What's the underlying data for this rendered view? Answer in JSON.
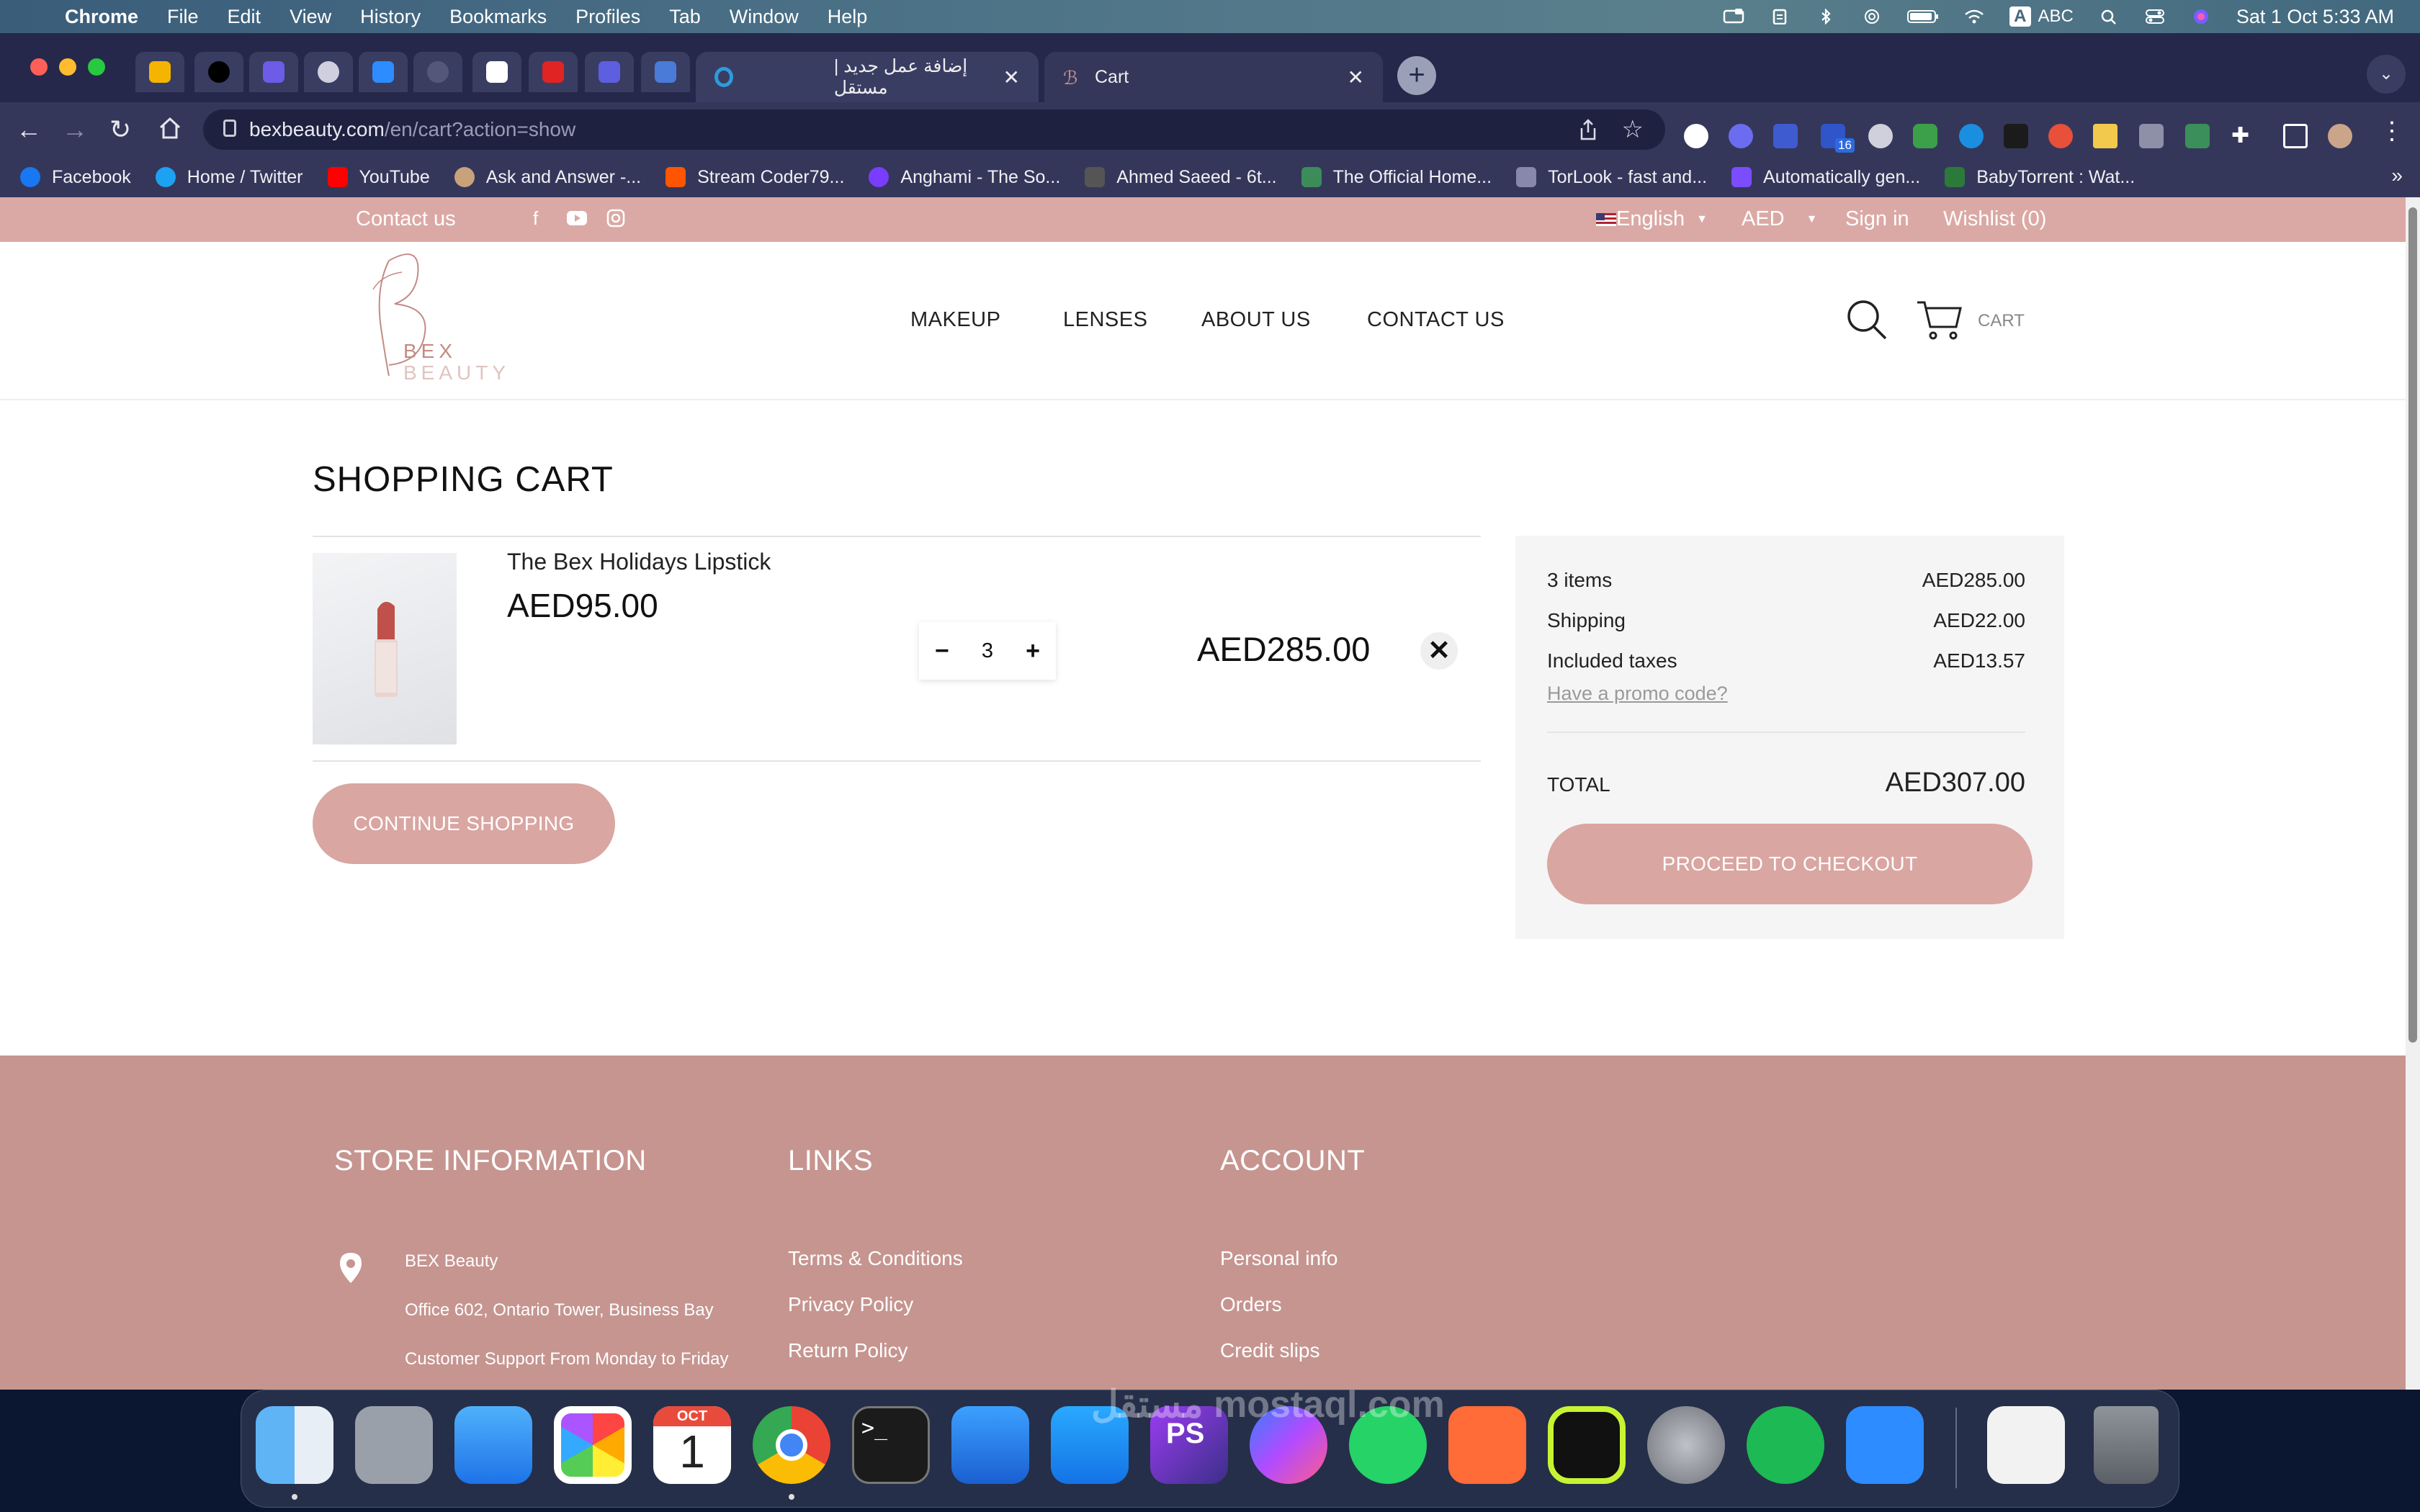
{
  "menubar": {
    "app": "Chrome",
    "items": [
      "File",
      "Edit",
      "View",
      "History",
      "Bookmarks",
      "Profiles",
      "Tab",
      "Window",
      "Help"
    ],
    "input_source": "ABC",
    "clock": "Sat 1 Oct  5:33 AM"
  },
  "browser": {
    "tabs": [
      {
        "title": "إضافة عمل جديد | مستقل"
      },
      {
        "title": "Cart"
      }
    ],
    "url_host": "bexbeauty.com",
    "url_path": "/en/cart?action=show",
    "extension_badge": "16",
    "bookmarks": [
      {
        "label": "Facebook",
        "color": "#1877f2"
      },
      {
        "label": "Home / Twitter",
        "color": "#1da1f2"
      },
      {
        "label": "YouTube",
        "color": "#ff0000"
      },
      {
        "label": "Ask and Answer -...",
        "color": "#c8a27a"
      },
      {
        "label": "Stream Coder79...",
        "color": "#ff5500"
      },
      {
        "label": "Anghami - The So...",
        "color": "#7a3cff"
      },
      {
        "label": "Ahmed Saeed - 6t...",
        "color": "#555555"
      },
      {
        "label": "The Official Home...",
        "color": "#3c8c5a"
      },
      {
        "label": "TorLook - fast and...",
        "color": "#8888aa"
      },
      {
        "label": "Automatically gen...",
        "color": "#7b4dff"
      },
      {
        "label": "BabyTorrent : Wat...",
        "color": "#2c7a3a"
      }
    ],
    "bookmarks_more": "»"
  },
  "site": {
    "topbar": {
      "contact": "Contact us",
      "language": "English",
      "currency": "AED",
      "sign_in": "Sign in",
      "wishlist": "Wishlist (0)"
    },
    "logo": {
      "line1": "BEX",
      "line2": "BEAUTY"
    },
    "nav": [
      "MAKEUP",
      "LENSES",
      "ABOUT US",
      "CONTACT US"
    ],
    "cart_label": "CART"
  },
  "cart": {
    "title": "SHOPPING CART",
    "item": {
      "name": "The Bex Holidays Lipstick",
      "unit_price": "AED95.00",
      "quantity": "3",
      "minus": "−",
      "plus": "+",
      "line_total": "AED285.00",
      "remove": "✕"
    },
    "continue_label": "CONTINUE SHOPPING"
  },
  "summary": {
    "rows": [
      {
        "label": "3 items",
        "value": "AED285.00"
      },
      {
        "label": "Shipping",
        "value": "AED22.00"
      },
      {
        "label": "Included taxes",
        "value": "AED13.57"
      }
    ],
    "promo": "Have a promo code?",
    "total_label": "TOTAL",
    "total_value": "AED307.00",
    "checkout_label": "PROCEED TO CHECKOUT"
  },
  "footer": {
    "store_title": "STORE INFORMATION",
    "store_lines": [
      "BEX Beauty",
      "Office 602, Ontario Tower, Business Bay",
      "Customer Support From Monday to Friday"
    ],
    "links_title": "LINKS",
    "links": [
      "Terms & Conditions",
      "Privacy Policy",
      "Return Policy"
    ],
    "account_title": "ACCOUNT",
    "account_links": [
      "Personal info",
      "Orders",
      "Credit slips"
    ]
  },
  "dock": {
    "calendar_month": "OCT",
    "calendar_day": "1",
    "terminal": ">_",
    "phpstorm": "PS",
    "watermark": "مستقل mostaql.com"
  },
  "colors": {
    "brand_pink": "#d9a6a2",
    "footer_pink": "#c69590",
    "topbar_pink": "#dba9a5"
  }
}
